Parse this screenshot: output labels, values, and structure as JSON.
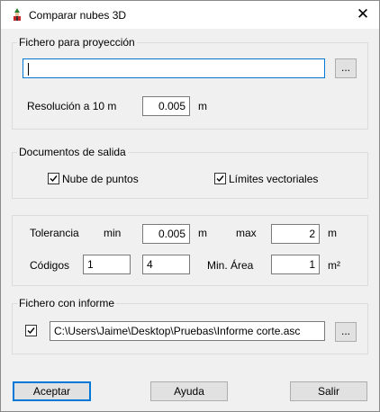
{
  "window": {
    "title": "Comparar nubes 3D",
    "close_glyph": "✕"
  },
  "projection": {
    "legend": "Fichero para proyección",
    "file_value": "",
    "browse_label": "...",
    "resolution_label": "Resolución a 10 m",
    "resolution_value": "0.005",
    "resolution_unit": "m"
  },
  "output": {
    "legend": "Documentos de salida",
    "point_cloud_label": "Nube de puntos",
    "point_cloud_checked": true,
    "vector_limits_label": "Límites vectoriales",
    "vector_limits_checked": true
  },
  "params": {
    "tolerance_label": "Tolerancia",
    "min_label": "min",
    "min_value": "0.005",
    "min_unit": "m",
    "max_label": "max",
    "max_value": "2",
    "max_unit": "m",
    "codes_label": "Códigos",
    "code_1": "1",
    "code_2": "4",
    "min_area_label": "Min. Área",
    "min_area_value": "1",
    "min_area_unit": "m²"
  },
  "report": {
    "legend": "Fichero con informe",
    "enabled": true,
    "path_value": "C:\\Users\\Jaime\\Desktop\\Pruebas\\Informe corte.asc",
    "browse_label": "..."
  },
  "buttons": {
    "accept": "Aceptar",
    "help": "Ayuda",
    "exit": "Salir"
  }
}
